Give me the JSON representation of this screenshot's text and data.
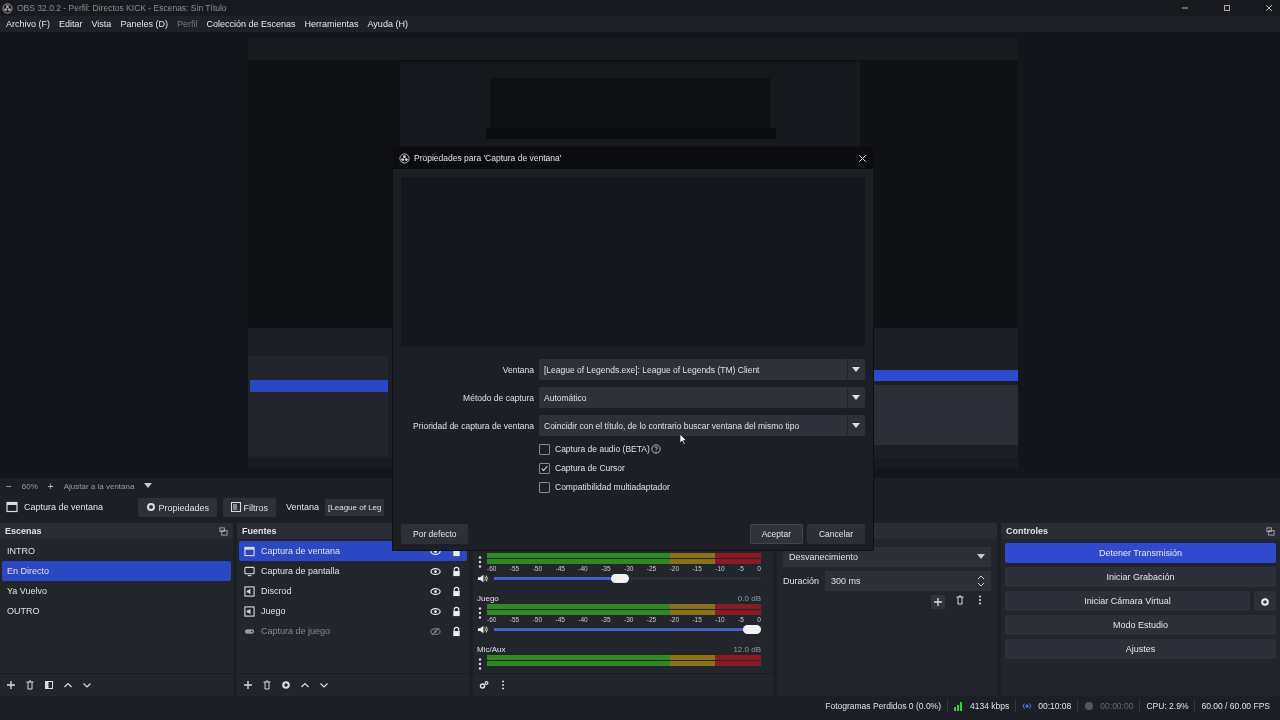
{
  "window": {
    "title": "OBS 32.0.2 - Perfil: Directos KICK - Escenas: Sin Título"
  },
  "menu": [
    {
      "label": "Archivo (F)",
      "disabled": false
    },
    {
      "label": "Editar",
      "disabled": false
    },
    {
      "label": "Vista",
      "disabled": false
    },
    {
      "label": "Paneles (D)",
      "disabled": false
    },
    {
      "label": "Perfil",
      "disabled": true
    },
    {
      "label": "Colección de Escenas",
      "disabled": false
    },
    {
      "label": "Herramientas",
      "disabled": false
    },
    {
      "label": "Ayuda (H)",
      "disabled": false
    }
  ],
  "zoom_bar": {
    "minus": "−",
    "zoom": "60%",
    "plus": "+",
    "fit": "Ajustar a la ventana"
  },
  "source_toolbar": {
    "source": "Captura de ventana",
    "buttons": [
      {
        "label": "Propiedades",
        "kind": "gear"
      },
      {
        "label": "Filtros",
        "kind": "filter"
      }
    ],
    "window_label": "Ventana",
    "window_value": "[League of Leg"
  },
  "scenes": {
    "title": "Escenas",
    "items": [
      {
        "label": "INTRO",
        "selected": false
      },
      {
        "label": "En Directo",
        "selected": true
      },
      {
        "label": "Ya Vuelvo",
        "selected": false
      },
      {
        "label": "OUTRO",
        "selected": false
      }
    ]
  },
  "sources": {
    "title": "Fuentes",
    "items": [
      {
        "label": "Captura de ventana",
        "kind": "window",
        "selected": true,
        "visible": true
      },
      {
        "label": "Captura de pantalla",
        "kind": "display",
        "selected": false,
        "visible": true
      },
      {
        "label": "Discrod",
        "kind": "audio",
        "selected": false,
        "visible": true
      },
      {
        "label": "Juego",
        "kind": "audio",
        "selected": false,
        "visible": true
      },
      {
        "label": "Captura de juego",
        "kind": "game",
        "selected": false,
        "visible": false
      }
    ]
  },
  "mixer": {
    "channels": [
      {
        "level": 0.47,
        "scale": [
          "-60",
          "-55",
          "-50",
          "-45",
          "-40",
          "-35",
          "-30",
          "-25",
          "-20",
          "-15",
          "-10",
          "-5",
          "0"
        ]
      },
      {
        "name": "Juego",
        "reading": "0.0 dB",
        "level": 1.0,
        "scale": [
          "-60",
          "-55",
          "-50",
          "-45",
          "-40",
          "-35",
          "-30",
          "-25",
          "-20",
          "-15",
          "-10",
          "-5",
          "0"
        ]
      },
      {
        "name": "Mic/Aux",
        "reading": "12.0 dB"
      }
    ]
  },
  "transitions": {
    "selected": "Desvanecimiento",
    "duration_label": "Duración",
    "duration": "300 ms"
  },
  "controls": {
    "title": "Controles",
    "buttons": [
      {
        "label": "Detener Transmisión",
        "active": true
      },
      {
        "label": "Iniciar Grabación",
        "active": false
      },
      {
        "label": "Iniciar Cámara Virtual",
        "active": false,
        "gear": true
      },
      {
        "label": "Modo Estudio",
        "active": false
      },
      {
        "label": "Ajustes",
        "active": false
      }
    ]
  },
  "status": {
    "dropped": "Fotogramas Perdidos 0 (0.0%)",
    "bitrate": "4134 kbps",
    "stream_time": "00:10:08",
    "rec_time": "00:00:00",
    "cpu": "CPU: 2.9%",
    "fps": "60.00 / 60.00 FPS"
  },
  "dialog": {
    "title": "Propiedades para 'Captura de ventana'",
    "fields": [
      {
        "label": "Ventana",
        "value": "[League of Legends.exe]: League of Legends (TM) Client"
      },
      {
        "label": "Método de captura",
        "value": "Automático"
      },
      {
        "label": "Prioridad de captura de ventana",
        "value": "Coincidir con el título, de lo contrario buscar ventana del mismo tipo"
      }
    ],
    "checkboxes": [
      {
        "label": "Captura de audio (BETA)",
        "checked": false,
        "help": true
      },
      {
        "label": "Captura de Cursor",
        "checked": true
      },
      {
        "label": "Compatibilidad multiadaptador",
        "checked": false
      }
    ],
    "default_button": "Por defecto",
    "ok_button": "Aceptar",
    "cancel_button": "Cancelar"
  }
}
